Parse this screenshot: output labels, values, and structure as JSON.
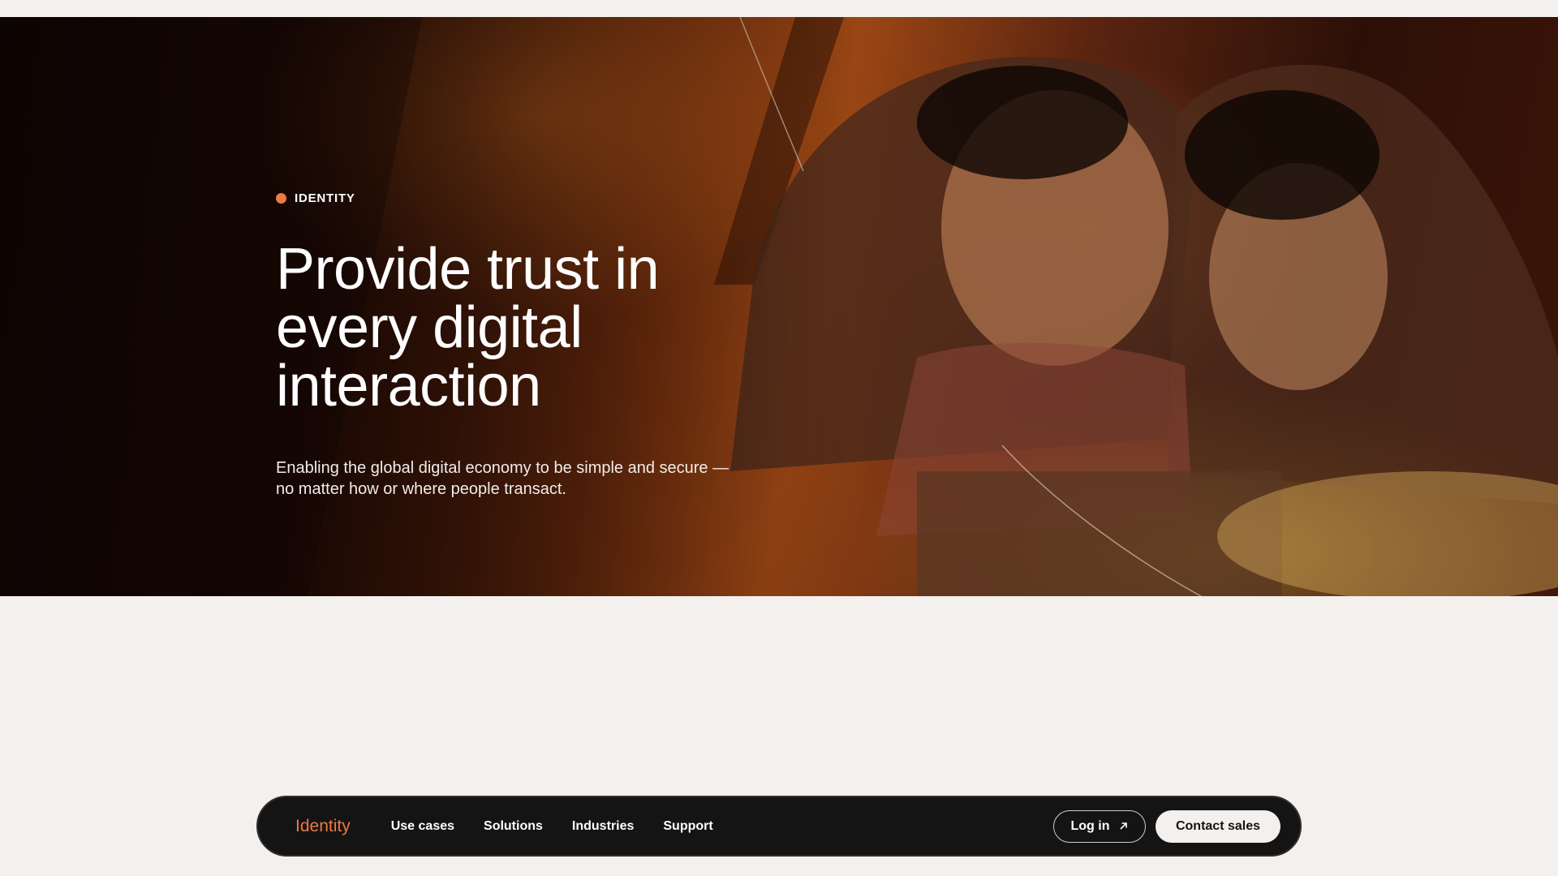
{
  "hero": {
    "eyebrow": "IDENTITY",
    "title_lines": [
      "Provide trust in",
      "every digital",
      "interaction"
    ],
    "subtitle_lines": [
      "Enabling the global digital economy to be simple and secure —",
      "no matter how or where people transact."
    ],
    "photo_icon": "family-with-tablet-photo"
  },
  "nav": {
    "brand": "Identity",
    "links": [
      "Use cases",
      "Solutions",
      "Industries",
      "Support"
    ],
    "login_label": "Log in",
    "login_icon": "arrow-up-right-icon",
    "contact_label": "Contact sales"
  },
  "colors": {
    "accent": "#ec7a45",
    "nav_bg": "#141414",
    "page_bg": "#f3f0ed"
  }
}
